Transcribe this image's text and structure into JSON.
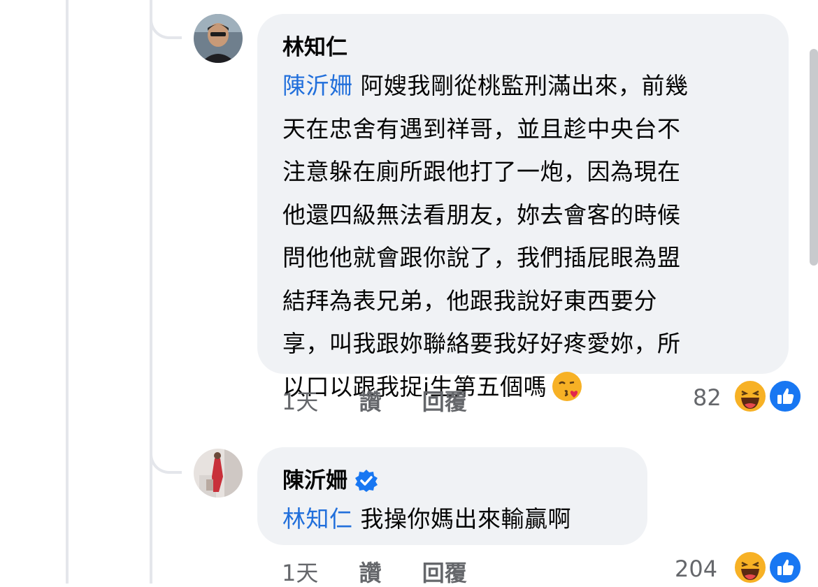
{
  "comments": [
    {
      "author": "林知仁",
      "mention": "陳沂姍",
      "lines": [
        "阿嫂我剛從桃監刑滿出來，前幾",
        "天在忠舍有遇到祥哥，並且趁中央台不",
        "注意躲在廁所跟他打了一炮，因為現在",
        "他還四級無法看朋友，妳去會客的時候",
        "問他他就會跟你說了，我們插屁眼為盟",
        "結拜為表兄弟，他跟我說好東西要分",
        "享，叫我跟妳聯絡要我好好疼愛妳，所",
        "以口以跟我捉i生第五個嗎"
      ],
      "emoji": "kissing-heart-emoji",
      "time": "1天",
      "like_label": "讚",
      "reply_label": "回覆",
      "reaction_count": "82",
      "reaction_icons": [
        "haha-icon",
        "like-icon"
      ]
    },
    {
      "author": "陳沂姍",
      "verified": true,
      "mention": "林知仁",
      "text": "我操你媽出來輸贏啊",
      "time": "1天",
      "like_label": "讚",
      "reply_label": "回覆",
      "reaction_count": "204",
      "reaction_icons": [
        "haha-icon",
        "like-icon"
      ]
    }
  ],
  "colors": {
    "bubble": "#f0f2f5",
    "mention": "#216fdb",
    "meta": "#65676b",
    "like_blue": "#1877f2",
    "haha_yellow": "#f7b125"
  }
}
